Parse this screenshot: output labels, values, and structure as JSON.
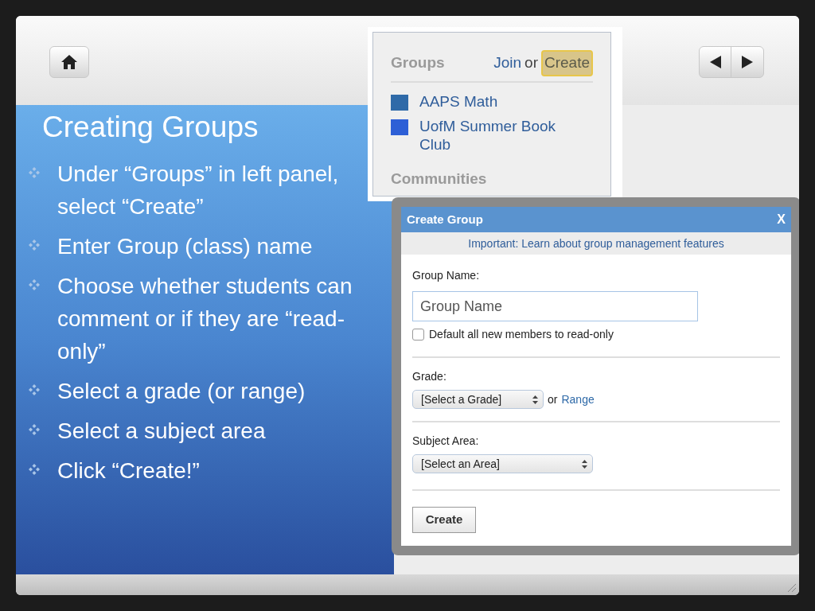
{
  "slide": {
    "title": "Creating Groups",
    "bullets": [
      "Under “Groups” in left panel, select “Create”",
      "Enter Group (class) name",
      "Choose whether students can comment or if they are “read-only”",
      "Select a grade (or range)",
      "Select a subject area",
      "Click “Create!”"
    ]
  },
  "groups_panel": {
    "heading": "Groups",
    "join": "Join",
    "or": "or",
    "create": {
      "label": "Create",
      "highlighted": true
    },
    "items": [
      {
        "label": "AAPS Math",
        "color": "#2f6aa8"
      },
      {
        "label": "UofM Summer Book Club",
        "color": "#2d5fd6"
      }
    ],
    "communities": "Communities"
  },
  "dialog": {
    "title": "Create Group",
    "close": "X",
    "notice": "Important: Learn about group management features",
    "name_label": "Group Name:",
    "name_placeholder": "Group Name",
    "read_only": {
      "label": "Default all new members to read-only",
      "checked": false
    },
    "grade_label": "Grade:",
    "grade_select": "[Select a Grade]",
    "or": "or",
    "range_link": "Range",
    "subject_label": "Subject Area:",
    "subject_select": "[Select an Area]",
    "button": "Create"
  }
}
